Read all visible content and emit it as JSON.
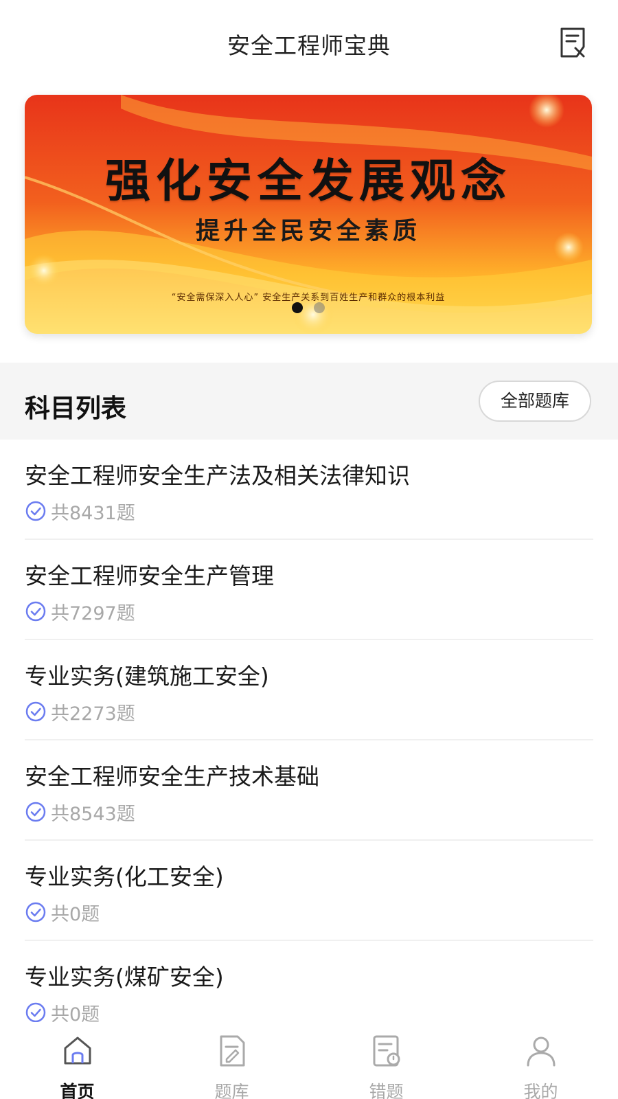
{
  "header": {
    "title": "安全工程师宝典",
    "notes_icon": "notes-icon"
  },
  "banner": {
    "headline": "强化安全发展观念",
    "subline": "提升全民安全素质",
    "tinyline": "“安全需保深入人心” 安全生产关系到百姓生产和群众的根本利益",
    "slide_count": 2,
    "active_slide": 1
  },
  "section": {
    "title": "科目列表",
    "all_button": "全部题库"
  },
  "subjects": [
    {
      "name": "安全工程师安全生产法及相关法律知识",
      "count": "共8431题"
    },
    {
      "name": "安全工程师安全生产管理",
      "count": "共7297题"
    },
    {
      "name": "专业实务(建筑施工安全)",
      "count": "共2273题"
    },
    {
      "name": "安全工程师安全生产技术基础",
      "count": "共8543题"
    },
    {
      "name": "专业实务(化工安全)",
      "count": "共0题"
    },
    {
      "name": "专业实务(煤矿安全)",
      "count": "共0题"
    }
  ],
  "tabbar": {
    "tabs": [
      {
        "label": "首页",
        "icon": "home-icon",
        "active": true
      },
      {
        "label": "题库",
        "icon": "question-bank-icon",
        "active": false
      },
      {
        "label": "错题",
        "icon": "wrong-questions-icon",
        "active": false
      },
      {
        "label": "我的",
        "icon": "user-icon",
        "active": false
      }
    ]
  },
  "colors": {
    "accent": "#6b7cf0",
    "muted_text": "#a8a8a8",
    "section_bg": "#f5f5f5",
    "banner_red": "#e8341a",
    "banner_gold": "#ffc02a"
  }
}
